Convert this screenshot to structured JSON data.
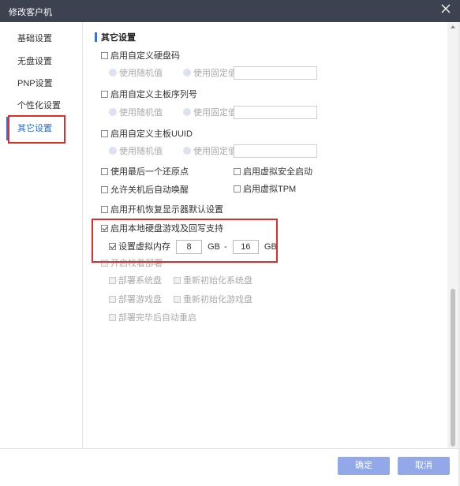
{
  "window": {
    "title": "修改客户机"
  },
  "sidebar": {
    "items": [
      {
        "label": "基础设置"
      },
      {
        "label": "无盘设置"
      },
      {
        "label": "PNP设置"
      },
      {
        "label": "个性化设置"
      },
      {
        "label": "其它设置"
      }
    ],
    "active_index": 4
  },
  "section": {
    "title": "其它设置"
  },
  "custom_disk_code": {
    "label": "启用自定义硬盘码",
    "checked": false,
    "radio_random": "使用随机值",
    "radio_fixed": "使用固定值",
    "value": ""
  },
  "custom_board_serial": {
    "label": "启用自定义主板序列号",
    "checked": false,
    "radio_random": "使用随机值",
    "radio_fixed": "使用固定值",
    "value": ""
  },
  "custom_board_uuid": {
    "label": "启用自定义主板UUID",
    "checked": false,
    "radio_random": "使用随机值",
    "radio_fixed": "使用固定值",
    "value": ""
  },
  "options": {
    "use_last_restore": "使用最后一个还原点",
    "virtual_safe_boot": "启用虚拟安全启动",
    "allow_wake": "允许关机后自动唤醒",
    "virtual_tpm": "启用虚拟TPM",
    "restore_display": "启用开机恢复显示器默认设置"
  },
  "local_disk": {
    "label": "启用本地硬盘游戏及回写支持",
    "checked": true,
    "virtual_mem_label": "设置虚拟内存",
    "virtual_mem_checked": true,
    "min_value": "8",
    "max_value": "16",
    "unit": "GB",
    "separator": "-"
  },
  "deploy": {
    "label": "开启校着部署",
    "system_disk": "部署系统盘",
    "reinit_system": "重新初始化系统盘",
    "game_disk": "部署游戏盘",
    "reinit_game": "重新初始化游戏盘",
    "auto_restart": "部署完毕后自动重启"
  },
  "footer": {
    "confirm": "确定",
    "cancel": "取消"
  },
  "colors": {
    "accent": "#3870dd",
    "highlight": "#d9302c",
    "button": "#92a8e8",
    "titlebar": "#3c4250"
  }
}
